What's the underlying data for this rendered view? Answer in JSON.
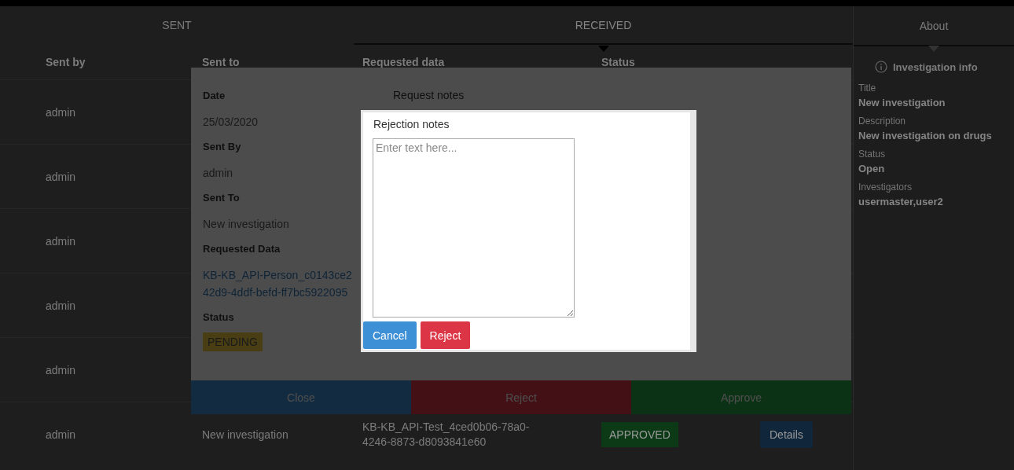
{
  "tabs": [
    {
      "label": "SENT",
      "selected": false
    },
    {
      "label": "RECEIVED",
      "selected": true
    }
  ],
  "table": {
    "columns": [
      "Sent by",
      "Sent to",
      "Requested data",
      "Status"
    ],
    "rows": [
      {
        "sent_by": "admin"
      },
      {
        "sent_by": "admin"
      },
      {
        "sent_by": "admin"
      },
      {
        "sent_by": "admin"
      },
      {
        "sent_by": "admin"
      },
      {
        "sent_by": "admin",
        "sent_to": "New investigation",
        "requested_data": "KB-KB_API-Test_4ced0b06-78a0-4246-8873-d8093841e60",
        "status": {
          "label": "APPROVED",
          "kind": "approved"
        },
        "action": "Details"
      }
    ]
  },
  "about": {
    "title": "About",
    "heading": "Investigation info",
    "fields": [
      {
        "label": "Title",
        "value": "New investigation"
      },
      {
        "label": "Description",
        "value": "New investigation on drugs"
      },
      {
        "label": "Status",
        "value": "Open"
      },
      {
        "label": "Investigators",
        "value": "usermaster,user2"
      }
    ]
  },
  "request_modal": {
    "details": [
      {
        "label": "Date",
        "kind": "text",
        "lines": [
          "25/03/2020"
        ]
      },
      {
        "label": "Sent By",
        "kind": "text",
        "lines": [
          "admin"
        ]
      },
      {
        "label": "Sent To",
        "kind": "text",
        "lines": [
          "New investigation"
        ]
      },
      {
        "label": "Requested Data",
        "kind": "link",
        "lines": [
          "KB-KB_API-Person_c0143ce2",
          "42d9-4ddf-befd-ff7bc5922095"
        ]
      },
      {
        "label": "Status",
        "kind": "pending",
        "lines": [
          "PENDING"
        ]
      }
    ],
    "notes_label": "Request notes",
    "buttons": [
      {
        "label": "Close",
        "kind": "close"
      },
      {
        "label": "Reject",
        "kind": "reject"
      },
      {
        "label": "Approve",
        "kind": "approve"
      }
    ]
  },
  "rejection_dialog": {
    "label": "Rejection notes",
    "placeholder": "Enter text here...",
    "buttons": [
      {
        "label": "Cancel",
        "kind": "cancel"
      },
      {
        "label": "Reject",
        "kind": "reject"
      }
    ]
  }
}
